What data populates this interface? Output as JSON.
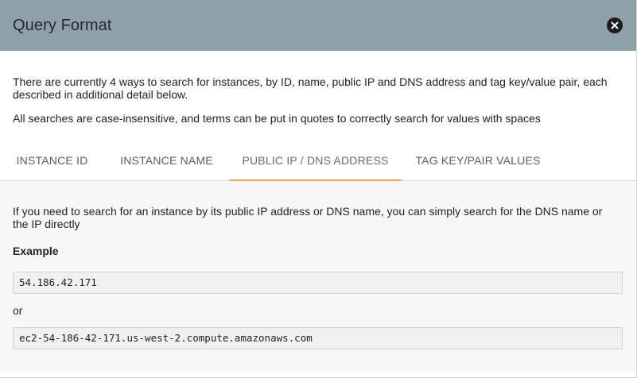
{
  "dialog": {
    "title": "Query Format",
    "close_icon": "close-icon"
  },
  "intro": {
    "line1": "There are currently 4 ways to search for instances, by ID, name, public IP and DNS address and tag key/value pair, each described in additional detail below.",
    "line2": "All searches are case-insensitive, and terms can be put in quotes to correctly search for values with spaces"
  },
  "tabs": [
    {
      "label": "INSTANCE ID",
      "active": false
    },
    {
      "label": "INSTANCE NAME",
      "active": false
    },
    {
      "label": "PUBLIC IP / DNS ADDRESS",
      "active": true
    },
    {
      "label": "TAG KEY/PAIR VALUES",
      "active": false
    }
  ],
  "panel": {
    "description": "If you need to search for an instance by its public IP address or DNS name, you can simply search for the DNS name or the IP directly",
    "example_label": "Example",
    "example_1": "54.186.42.171",
    "or_text": "or",
    "example_2": "ec2-54-186-42-171.us-west-2.compute.amazonaws.com"
  },
  "colors": {
    "header_bg": "#8fa0a9",
    "active_tab_underline": "#f5a55a",
    "panel_bg": "#f7f7f7"
  }
}
